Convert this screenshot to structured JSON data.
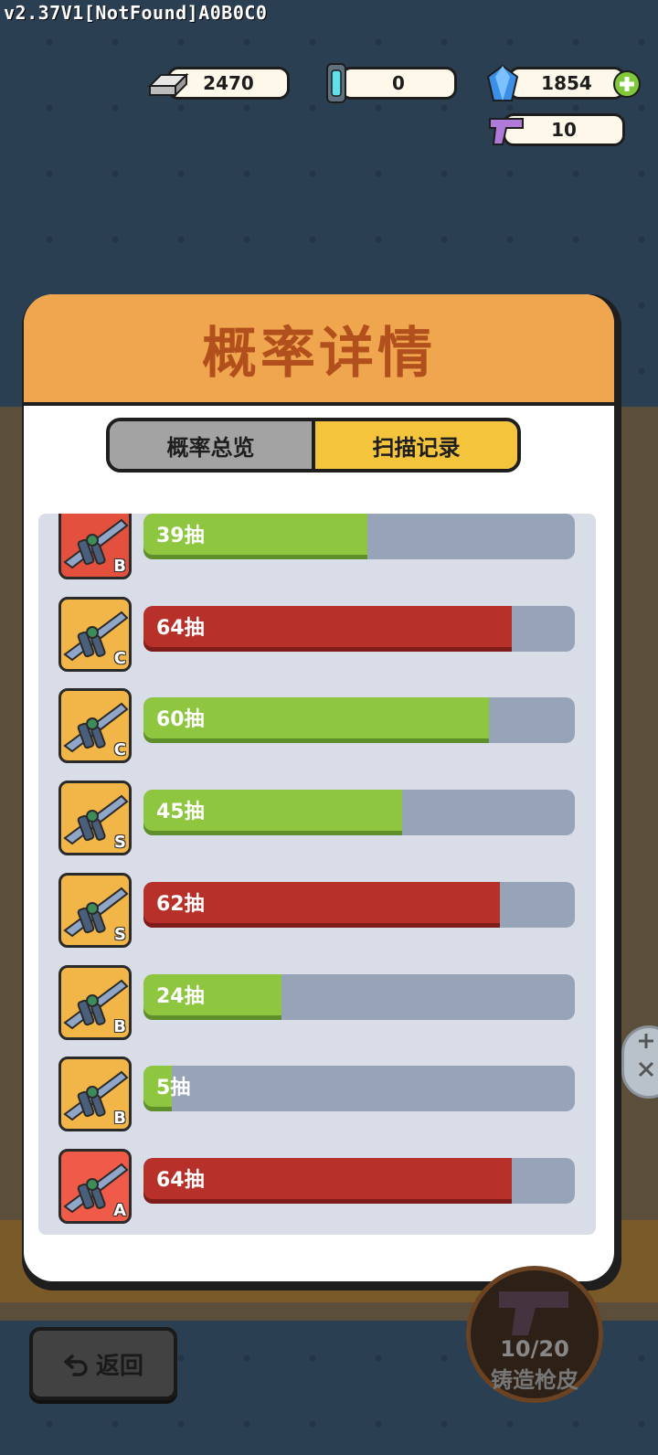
{
  "version": "v2.37V1[NotFound]A0B0C0",
  "resources": {
    "silver": "2470",
    "capsule": "0",
    "gem": "1854",
    "gun_ticket": "10"
  },
  "modal": {
    "title": "概率详情",
    "tabs": [
      "概率总览",
      "扫描记录"
    ],
    "active_tab": "扫描记录"
  },
  "records": [
    {
      "grade": "B",
      "label": "39抽",
      "draws": 39,
      "color": "green",
      "tile": "#e3503d"
    },
    {
      "grade": "C",
      "label": "64抽",
      "draws": 64,
      "color": "red",
      "tile": "#f2b648"
    },
    {
      "grade": "C",
      "label": "60抽",
      "draws": 60,
      "color": "green",
      "tile": "#f2b648"
    },
    {
      "grade": "S",
      "label": "45抽",
      "draws": 45,
      "color": "green",
      "tile": "#f2b648"
    },
    {
      "grade": "S",
      "label": "62抽",
      "draws": 62,
      "color": "red",
      "tile": "#f2b648"
    },
    {
      "grade": "B",
      "label": "24抽",
      "draws": 24,
      "color": "green",
      "tile": "#f2b648"
    },
    {
      "grade": "B",
      "label": "5抽",
      "draws": 5,
      "color": "green",
      "tile": "#f2b648"
    },
    {
      "grade": "A",
      "label": "64抽",
      "draws": 64,
      "color": "red",
      "tile": "#ef5b48"
    }
  ],
  "bar_max": 75,
  "bottom": {
    "back_label": "返回",
    "forge_count": "10/20",
    "forge_label": "铸造枪皮"
  },
  "colors": {
    "header": "#f0a54f",
    "title": "#b1501c",
    "tab_active": "#f4c43c",
    "tab_inactive": "#a3a3a3",
    "bar_green": "#8ec63f",
    "bar_red": "#b8302a",
    "bar_track": "#97a3b6"
  }
}
